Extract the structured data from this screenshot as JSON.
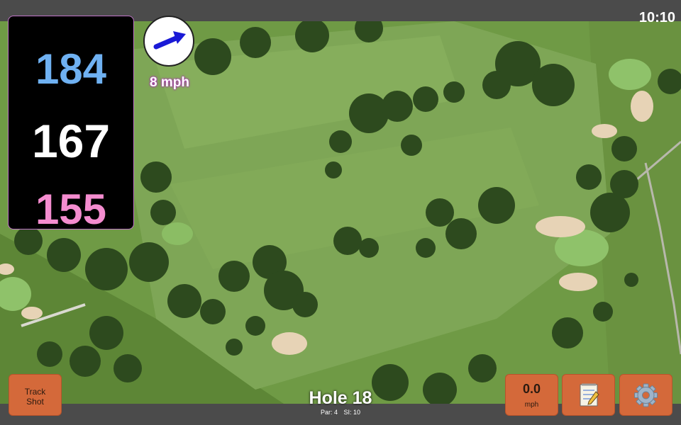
{
  "clock": "10:10",
  "yardage": {
    "back": "184",
    "middle": "167",
    "front": "155"
  },
  "wind": {
    "speed_label": "8 mph",
    "direction_icon": "wind-arrow-icon"
  },
  "hole": {
    "title": "Hole 18",
    "par": "Par: 4",
    "si": "SI: 10"
  },
  "buttons": {
    "track_line1": "Track",
    "track_line2": "Shot",
    "speed_value": "0.0",
    "speed_unit": "mph",
    "notes_icon": "notepad-icon",
    "settings_icon": "gear-icon"
  },
  "colors": {
    "back_yardage": "#6fb1f2",
    "middle_yardage": "#ffffff",
    "front_yardage": "#f48ccf",
    "button": "#d4693a"
  }
}
